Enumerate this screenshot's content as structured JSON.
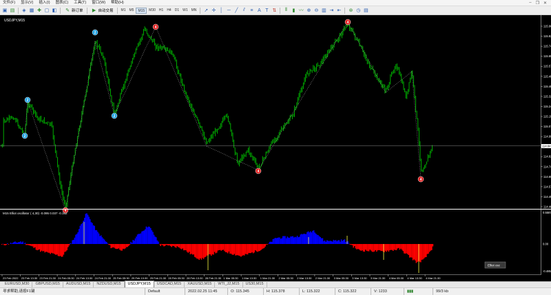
{
  "menu": {
    "items": [
      "文件(F)",
      "显示(V)",
      "插入(I)",
      "图表(C)",
      "工具(T)",
      "窗口(W)",
      "帮助(H)"
    ]
  },
  "toolbar": {
    "new_order_label": "新订单",
    "autotrade_label": "自动交易",
    "timeframes": [
      "M1",
      "M5",
      "M15",
      "M30",
      "H1",
      "H4",
      "D1",
      "W1",
      "MN"
    ],
    "active_timeframe": "M15"
  },
  "chart": {
    "symbol_label": "USDJPY,M15",
    "price_labels": [
      "115.90",
      "115.82",
      "115.74",
      "115.65",
      "115.57",
      "115.49",
      "115.40",
      "115.32",
      "115.24",
      "115.15",
      "115.07",
      "114.99",
      "114.90",
      "114.82",
      "114.74",
      "114.65",
      "114.57",
      "114.49",
      "114.40"
    ],
    "current_price": "114.84",
    "time_labels": [
      "23 Feb 2022",
      "23 Feb 13:30",
      "23 Feb 21:30",
      "24 Feb 05:30",
      "24 Feb 13:30",
      "24 Feb 21:30",
      "25 Feb 05:30",
      "25 Feb 13:30",
      "25 Feb 21:30",
      "28 Feb 05:30",
      "28 Feb 13:30",
      "28 Feb 21:30",
      "1 Mar 05:30",
      "1 Mar 13:30",
      "1 Mar 21:30",
      "2 Mar 05:30",
      "2 Mar 13:30",
      "2 Mar 21:30",
      "3 Mar 05:30",
      "3 Mar 13:30",
      "3 Mar 21:30",
      "4 Mar 05:30",
      "4 Mar 13:30",
      "4 Mar 21:30"
    ],
    "wave_labels": [
      {
        "text": "2",
        "style": "blue"
      },
      {
        "text": "2",
        "style": "blue"
      },
      {
        "text": "4",
        "style": "red"
      },
      {
        "text": "2",
        "style": "blue"
      },
      {
        "text": "2",
        "style": "blue"
      },
      {
        "text": "4",
        "style": "red"
      },
      {
        "text": "4",
        "style": "red"
      },
      {
        "text": "4",
        "style": "red"
      },
      {
        "text": "4",
        "style": "red"
      }
    ],
    "colors": {
      "background": "#000000",
      "candles": "#00c000",
      "hist_up": "#0000ff",
      "hist_down": "#ff0000",
      "wave_blue": "#1ea0e0",
      "wave_red": "#e02020"
    }
  },
  "indicator": {
    "label": "M15 Elliot oscillator ( 4,30) -0.095 0.037 -0.162",
    "scale_labels": [
      "0.5587",
      "0.00",
      "-0.4856"
    ],
    "button_label": "Elliot osc"
  },
  "tabs": [
    "EURUSD,M30",
    "GBPUSD,M15",
    "AUDUSD,M15",
    "NZDUSD,M15",
    "USDJPY,M15",
    "USDCAD,M15",
    "XAUUSD,M15",
    "WTI_J2,M15",
    "US30,M15"
  ],
  "active_tab": "USDJPY,M15",
  "status": {
    "help": "寻求帮助,请按F1键",
    "profile": "Default",
    "time": "2022.02.25 11:45",
    "open": "O: 115.345",
    "high": "H: 115.378",
    "low": "L: 115.322",
    "close": "C: 115.322",
    "volume": "V: 1233",
    "traffic": "99/3 kb"
  }
}
